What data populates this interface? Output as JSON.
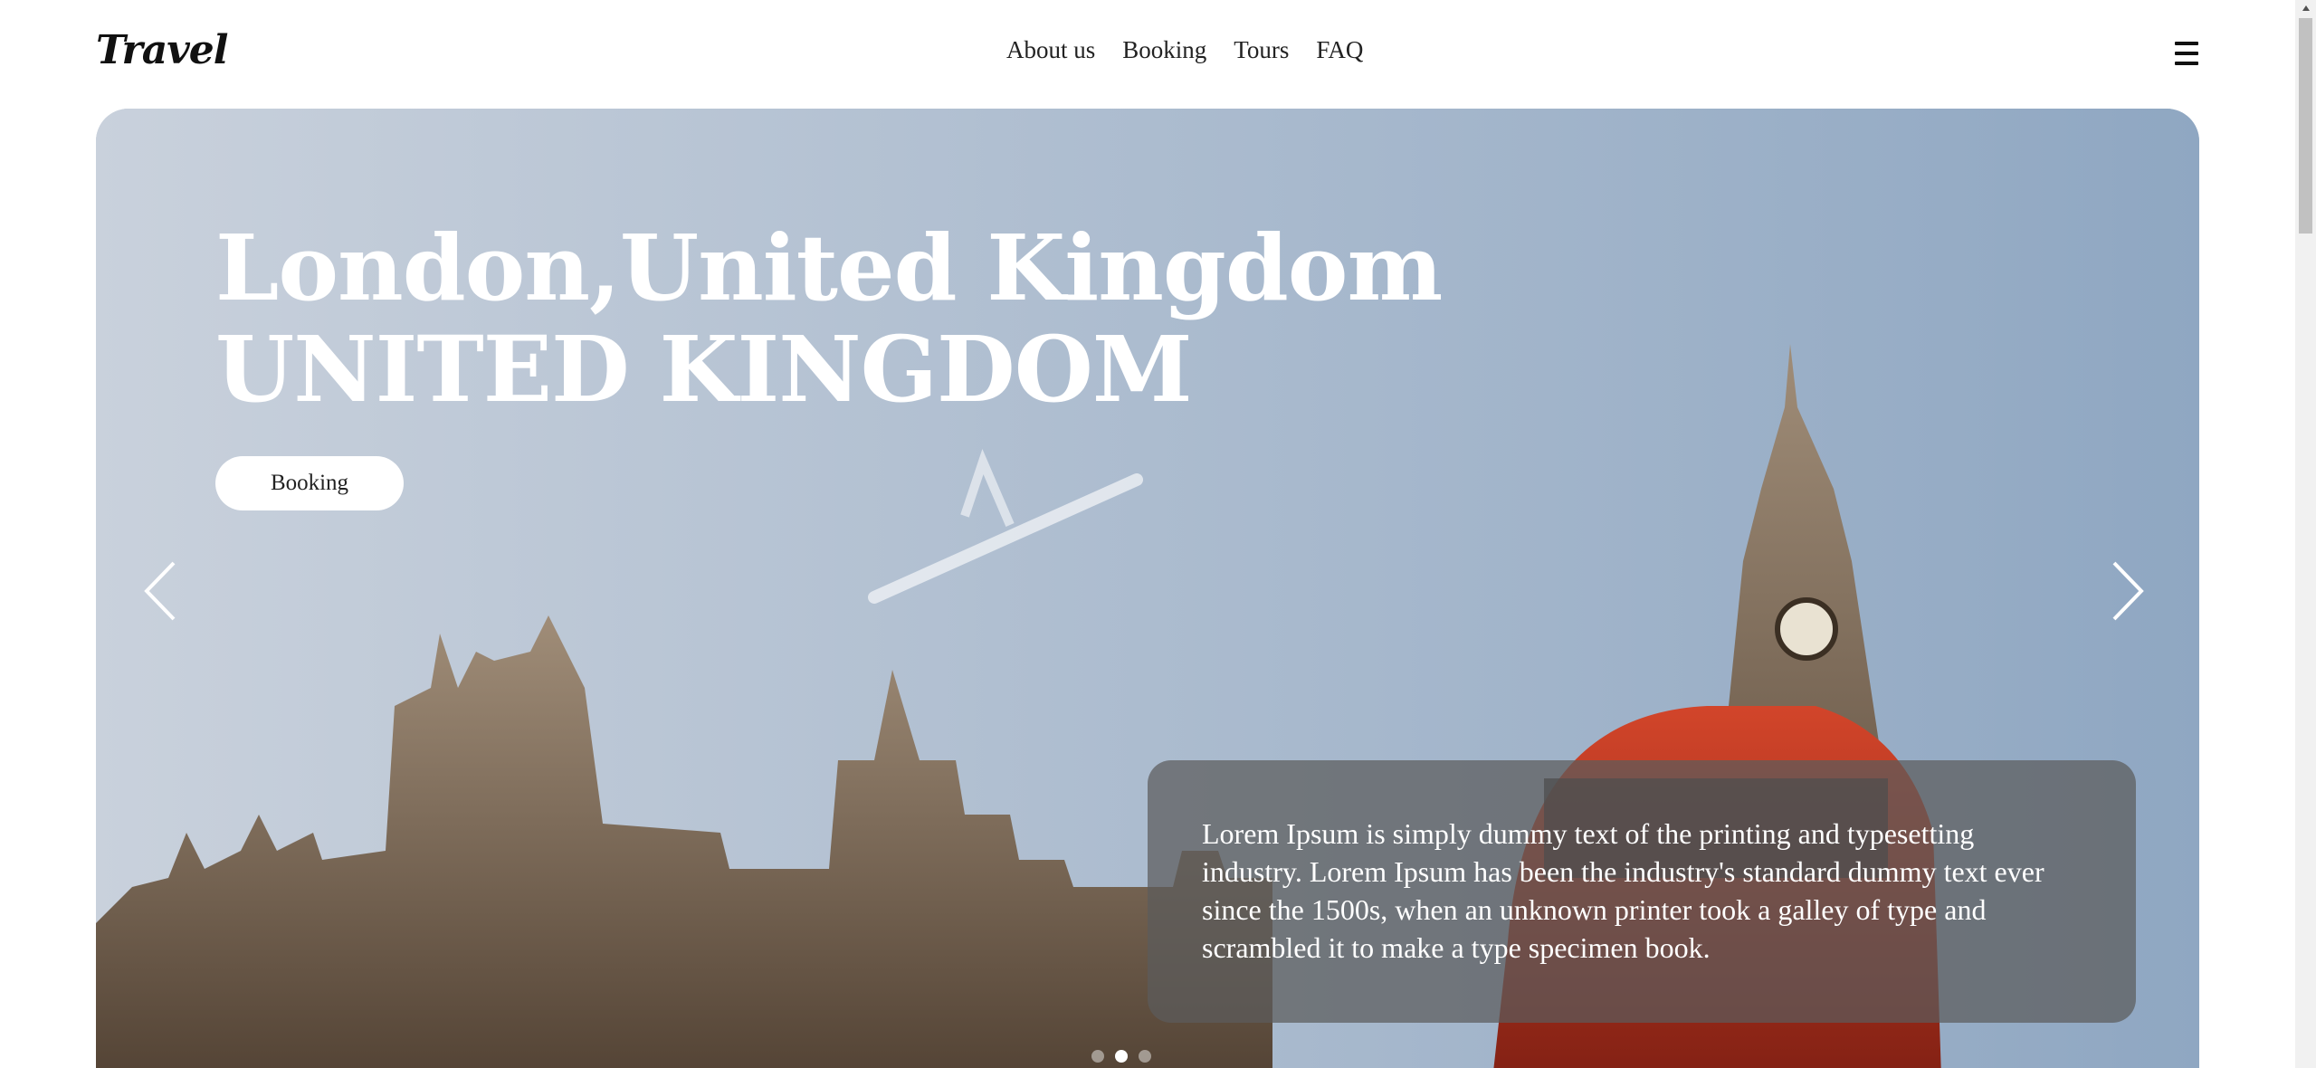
{
  "header": {
    "logo": "Travel",
    "nav": [
      "About us",
      "Booking",
      "Tours",
      "FAQ"
    ]
  },
  "hero": {
    "title_line1": "London,United Kingdom",
    "title_line2": "UNITED KINGDOM",
    "booking_label": "Booking",
    "description": "Lorem Ipsum is simply dummy text of the printing and typesetting industry. Lorem Ipsum has been the industry's standard dummy text ever since the 1500s, when an unknown printer took a galley of type and scrambled it to make a type specimen book.",
    "slide_indicators": [
      false,
      true,
      false
    ]
  },
  "icons": {
    "menu": "hamburger-menu-icon",
    "prev": "chevron-left-icon",
    "next": "chevron-right-icon"
  }
}
